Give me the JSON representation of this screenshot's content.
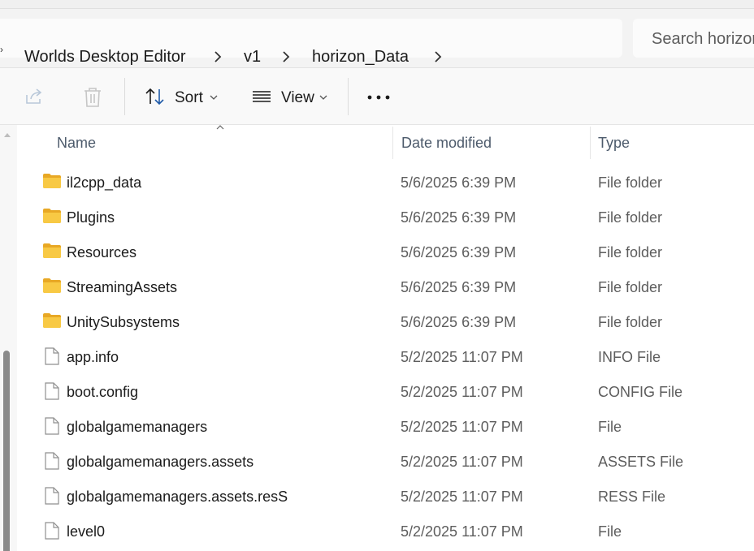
{
  "breadcrumb": {
    "items": [
      "Worlds Desktop Editor",
      "v1",
      "horizon_Data"
    ]
  },
  "search": {
    "placeholder": "Search horizon_Data"
  },
  "toolbar": {
    "sort_label": "Sort",
    "view_label": "View"
  },
  "columns": {
    "name": "Name",
    "date": "Date modified",
    "type": "Type"
  },
  "files": [
    {
      "name": "il2cpp_data",
      "date": "5/6/2025 6:39 PM",
      "type": "File folder",
      "icon": "folder-icon"
    },
    {
      "name": "Plugins",
      "date": "5/6/2025 6:39 PM",
      "type": "File folder",
      "icon": "folder-icon"
    },
    {
      "name": "Resources",
      "date": "5/6/2025 6:39 PM",
      "type": "File folder",
      "icon": "folder-icon"
    },
    {
      "name": "StreamingAssets",
      "date": "5/6/2025 6:39 PM",
      "type": "File folder",
      "icon": "folder-icon"
    },
    {
      "name": "UnitySubsystems",
      "date": "5/6/2025 6:39 PM",
      "type": "File folder",
      "icon": "folder-icon"
    },
    {
      "name": "app.info",
      "date": "5/2/2025 11:07 PM",
      "type": "INFO File",
      "icon": "file-icon"
    },
    {
      "name": "boot.config",
      "date": "5/2/2025 11:07 PM",
      "type": "CONFIG File",
      "icon": "file-icon"
    },
    {
      "name": "globalgamemanagers",
      "date": "5/2/2025 11:07 PM",
      "type": "File",
      "icon": "file-icon"
    },
    {
      "name": "globalgamemanagers.assets",
      "date": "5/2/2025 11:07 PM",
      "type": "ASSETS File",
      "icon": "file-icon"
    },
    {
      "name": "globalgamemanagers.assets.resS",
      "date": "5/2/2025 11:07 PM",
      "type": "RESS File",
      "icon": "file-icon"
    },
    {
      "name": "level0",
      "date": "5/2/2025 11:07 PM",
      "type": "File",
      "icon": "file-icon"
    }
  ],
  "colors": {
    "folder": "#F8C944",
    "header_text": "#4C5A6B",
    "secondary_text": "#5D5D5D"
  }
}
